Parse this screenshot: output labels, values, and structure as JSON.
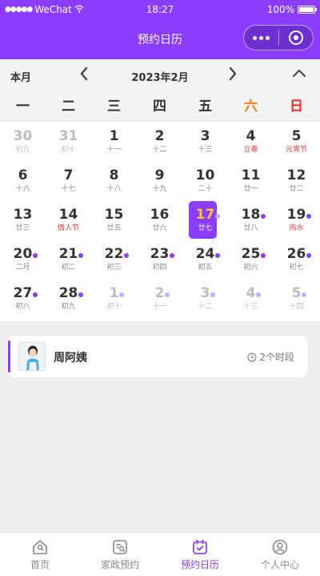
{
  "status_bar": {
    "carrier": "WeChat",
    "time": "18:27",
    "battery": "100%",
    "battery_level": 1.0
  },
  "nav": {
    "title": "预约日历"
  },
  "calendar": {
    "this_month": "本月",
    "month_title": "2023年2月",
    "weekdays": [
      "一",
      "二",
      "三",
      "四",
      "五",
      "六",
      "日"
    ],
    "weeks": [
      [
        {
          "day": "30",
          "lunar": "初九",
          "other": true
        },
        {
          "day": "31",
          "lunar": "初十",
          "other": true
        },
        {
          "day": "1",
          "lunar": "十一"
        },
        {
          "day": "2",
          "lunar": "十二"
        },
        {
          "day": "3",
          "lunar": "十三"
        },
        {
          "day": "4",
          "lunar": "立春",
          "festival": true
        },
        {
          "day": "5",
          "lunar": "元宵节",
          "festival": true
        }
      ],
      [
        {
          "day": "6",
          "lunar": "十六"
        },
        {
          "day": "7",
          "lunar": "十七"
        },
        {
          "day": "8",
          "lunar": "十八"
        },
        {
          "day": "9",
          "lunar": "十九"
        },
        {
          "day": "10",
          "lunar": "二十"
        },
        {
          "day": "11",
          "lunar": "廿一"
        },
        {
          "day": "12",
          "lunar": "廿二"
        }
      ],
      [
        {
          "day": "13",
          "lunar": "廿三"
        },
        {
          "day": "14",
          "lunar": "情人节",
          "festival": true
        },
        {
          "day": "15",
          "lunar": "廿五"
        },
        {
          "day": "16",
          "lunar": "廿六"
        },
        {
          "day": "17",
          "lunar": "廿七",
          "today": true,
          "dot": true
        },
        {
          "day": "18",
          "lunar": "廿八",
          "dot": true
        },
        {
          "day": "19",
          "lunar": "雨水",
          "festival": true,
          "dot": true
        }
      ],
      [
        {
          "day": "20",
          "lunar": "二月",
          "dot": true
        },
        {
          "day": "21",
          "lunar": "初二",
          "dot": true
        },
        {
          "day": "22",
          "lunar": "初三",
          "dot": true
        },
        {
          "day": "23",
          "lunar": "初四",
          "dot": true
        },
        {
          "day": "24",
          "lunar": "初五",
          "dot": true
        },
        {
          "day": "25",
          "lunar": "初六",
          "dot": true
        },
        {
          "day": "26",
          "lunar": "初七",
          "dot": true
        }
      ],
      [
        {
          "day": "27",
          "lunar": "初八",
          "dot": true
        },
        {
          "day": "28",
          "lunar": "初九",
          "dot": true
        },
        {
          "day": "1",
          "lunar": "初十",
          "other": true,
          "dot": true
        },
        {
          "day": "2",
          "lunar": "十一",
          "other": true,
          "dot": true
        },
        {
          "day": "3",
          "lunar": "十二",
          "other": true,
          "dot": true
        },
        {
          "day": "4",
          "lunar": "十三",
          "other": true,
          "dot": true
        },
        {
          "day": "5",
          "lunar": "十四",
          "other": true,
          "dot": true
        }
      ]
    ]
  },
  "appointment": {
    "name": "周阿姨",
    "slots": "2个时段"
  },
  "tabbar": {
    "items": [
      {
        "label": "首页",
        "icon": "home-icon"
      },
      {
        "label": "家政预约",
        "icon": "booking-icon"
      },
      {
        "label": "预约日历",
        "icon": "calendar-icon",
        "active": true
      },
      {
        "label": "个人中心",
        "icon": "user-icon"
      }
    ]
  },
  "colors": {
    "primary": "#8b3dff",
    "saturday": "#ff7a18",
    "sunday": "#f02d2d",
    "festival": "#e23a3a",
    "today_number": "#ffc21a"
  }
}
